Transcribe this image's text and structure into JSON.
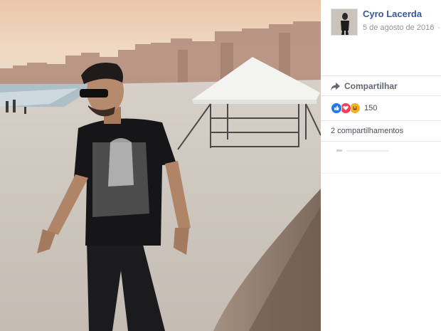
{
  "photo": {
    "description_icon": "photo-of-person-on-beach"
  },
  "post": {
    "author": "Cyro Lacerda",
    "date": "5 de agosto de 2016",
    "audience_separator": "·",
    "audience_icon": "globe-icon"
  },
  "actions": {
    "share_label": "Compartilhar",
    "share_icon": "share-arrow-icon"
  },
  "reactions": {
    "icons": [
      "like-icon",
      "love-icon",
      "haha-icon"
    ],
    "count": "150"
  },
  "shares": {
    "label": "2 compartilhamentos"
  },
  "colors": {
    "author": "#365899",
    "like": "#2078f4",
    "love": "#f33e58",
    "haha": "#f7b125"
  }
}
